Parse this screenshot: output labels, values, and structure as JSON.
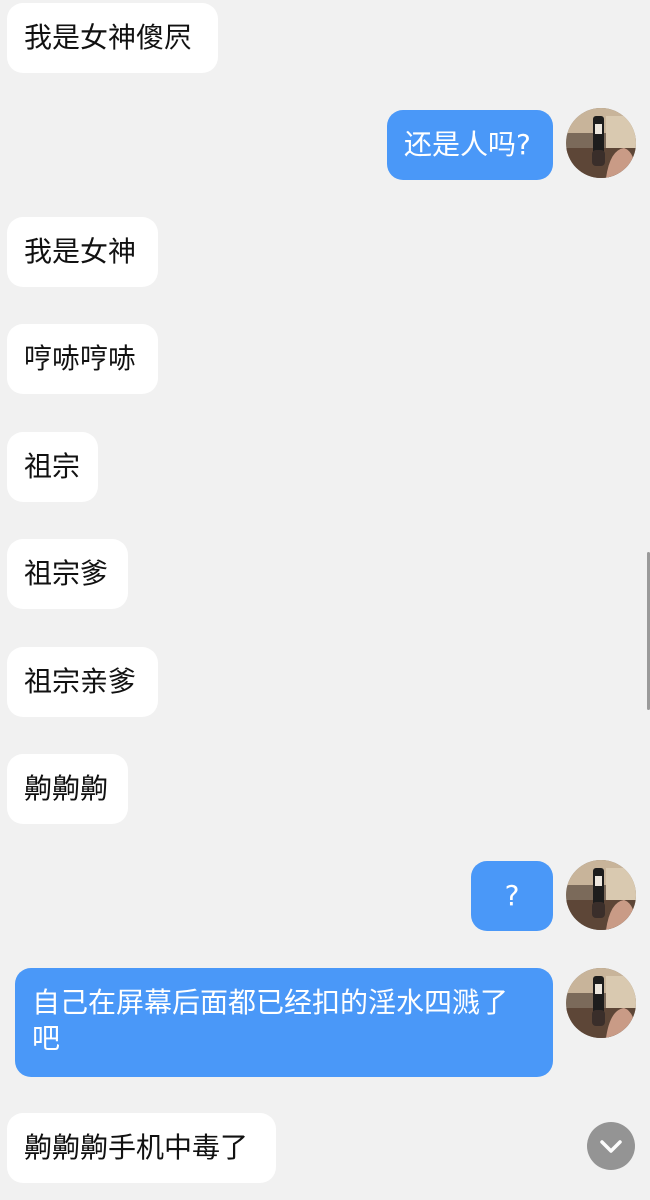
{
  "messages": [
    {
      "direction": "in",
      "text": "我是女神傻屄"
    },
    {
      "direction": "out",
      "text": "还是人吗?",
      "avatar": "avatar-photo"
    },
    {
      "direction": "in",
      "text": "我是女神"
    },
    {
      "direction": "in",
      "text": "哼哧哼哧"
    },
    {
      "direction": "in",
      "text": "祖宗"
    },
    {
      "direction": "in",
      "text": "祖宗爹"
    },
    {
      "direction": "in",
      "text": "祖宗亲爹"
    },
    {
      "direction": "in",
      "text": "齁齁齁"
    },
    {
      "direction": "out",
      "text": "?",
      "avatar": "avatar-photo"
    },
    {
      "direction": "out",
      "text": "自己在屏幕后面都已经扣的淫水四溅了\n吧",
      "avatar": "avatar-photo"
    },
    {
      "direction": "in",
      "text": "齁齁齁手机中毒了"
    }
  ],
  "colors": {
    "background": "#f1f1f1",
    "incoming_bubble": "#ffffff",
    "outgoing_bubble": "#4a98f8",
    "scroll_button": "#8d8d8d"
  },
  "icons": {
    "scroll_down": "chevron-down-icon"
  }
}
